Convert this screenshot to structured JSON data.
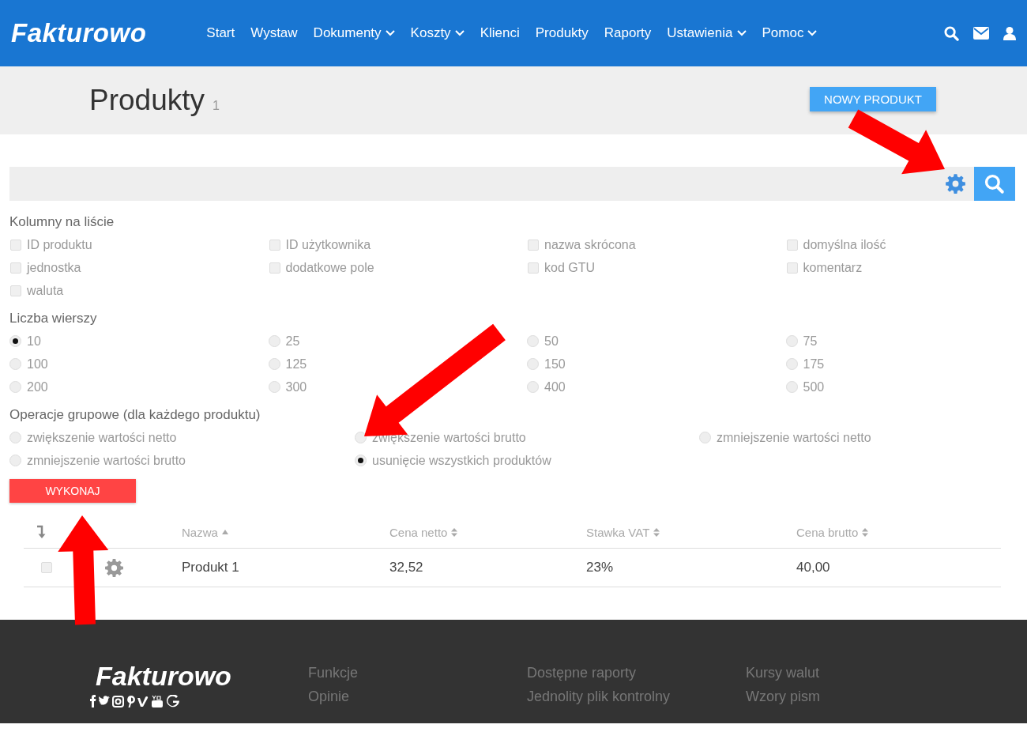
{
  "header": {
    "logo": "Fakturowo",
    "nav": [
      {
        "label": "Start",
        "dropdown": false
      },
      {
        "label": "Wystaw",
        "dropdown": false
      },
      {
        "label": "Dokumenty",
        "dropdown": true
      },
      {
        "label": "Koszty",
        "dropdown": true
      },
      {
        "label": "Klienci",
        "dropdown": false
      },
      {
        "label": "Produkty",
        "dropdown": false
      },
      {
        "label": "Raporty",
        "dropdown": false
      },
      {
        "label": "Ustawienia",
        "dropdown": true
      },
      {
        "label": "Pomoc",
        "dropdown": true
      }
    ]
  },
  "title_band": {
    "title": "Produkty",
    "count": "1",
    "new_button": "NOWY PRODUKT"
  },
  "columns_panel": {
    "title": "Kolumny na liście",
    "options": [
      {
        "label": "ID produktu",
        "checked": false
      },
      {
        "label": "ID użytkownika",
        "checked": false
      },
      {
        "label": "nazwa skrócona",
        "checked": false
      },
      {
        "label": "domyślna ilość",
        "checked": false
      },
      {
        "label": "jednostka",
        "checked": false
      },
      {
        "label": "dodatkowe pole",
        "checked": false
      },
      {
        "label": "kod GTU",
        "checked": false
      },
      {
        "label": "komentarz",
        "checked": false
      },
      {
        "label": "waluta",
        "checked": false
      }
    ]
  },
  "rows_panel": {
    "title": "Liczba wierszy",
    "options": [
      {
        "label": "10",
        "selected": true
      },
      {
        "label": "25",
        "selected": false
      },
      {
        "label": "50",
        "selected": false
      },
      {
        "label": "75",
        "selected": false
      },
      {
        "label": "100",
        "selected": false
      },
      {
        "label": "125",
        "selected": false
      },
      {
        "label": "150",
        "selected": false
      },
      {
        "label": "175",
        "selected": false
      },
      {
        "label": "200",
        "selected": false
      },
      {
        "label": "300",
        "selected": false
      },
      {
        "label": "400",
        "selected": false
      },
      {
        "label": "500",
        "selected": false
      }
    ]
  },
  "operations_panel": {
    "title": "Operacje grupowe (dla każdego produktu)",
    "options": [
      {
        "label": "zwiększenie wartości netto",
        "selected": false
      },
      {
        "label": "zwiększenie wartości brutto",
        "selected": false
      },
      {
        "label": "zmniejszenie wartości netto",
        "selected": false
      },
      {
        "label": "zmniejszenie wartości brutto",
        "selected": false
      },
      {
        "label": "usunięcie wszystkich produktów",
        "selected": true
      }
    ],
    "execute_button": "WYKONAJ"
  },
  "table": {
    "columns": [
      {
        "label": "Nazwa",
        "sorted": true
      },
      {
        "label": "Cena netto",
        "sorted": false
      },
      {
        "label": "Stawka VAT",
        "sorted": false
      },
      {
        "label": "Cena brutto",
        "sorted": false
      }
    ],
    "rows": [
      {
        "checked": false,
        "cells": [
          "Produkt 1",
          "32,52",
          "23%",
          "40,00"
        ]
      }
    ]
  },
  "footer": {
    "logo": "Fakturowo",
    "link_columns": [
      [
        "Funkcje",
        "Opinie"
      ],
      [
        "Dostępne raporty",
        "Jednolity plik kontrolny"
      ],
      [
        "Kursy walut",
        "Wzory pism"
      ]
    ]
  }
}
